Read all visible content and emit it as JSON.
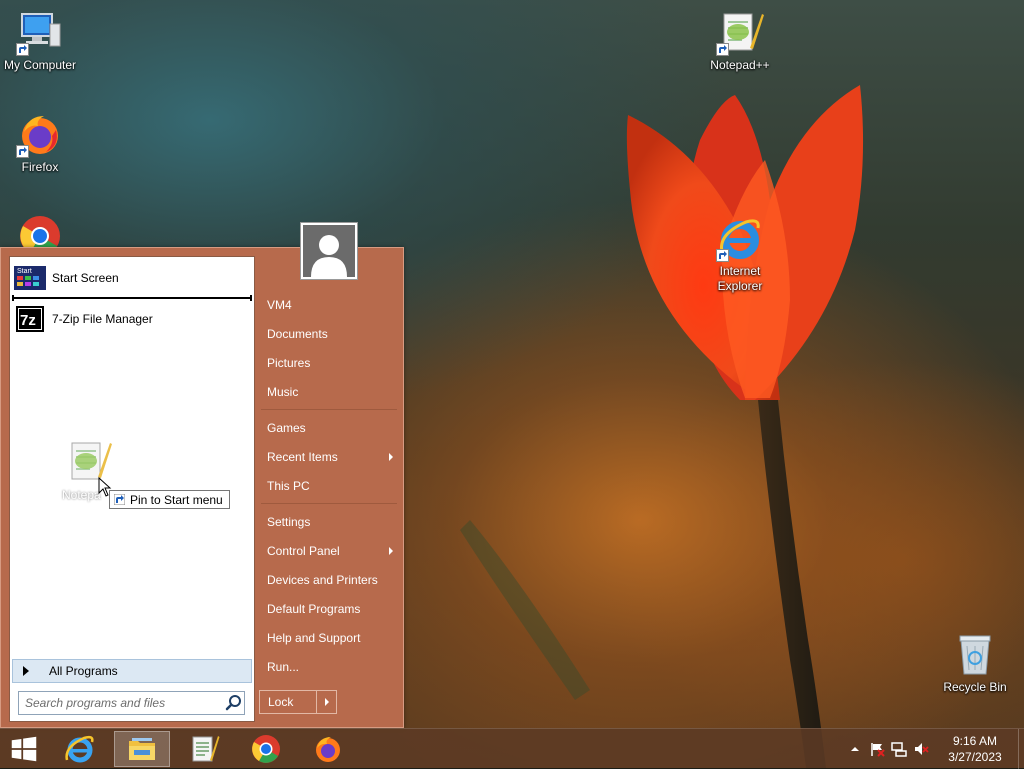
{
  "desktop": {
    "icons": [
      {
        "label": "My Computer",
        "icon": "computer-icon"
      },
      {
        "label": "Firefox",
        "icon": "firefox-icon"
      },
      {
        "label": "Notepad++",
        "icon": "notepadpp-icon"
      },
      {
        "label": "Internet Explorer",
        "icon": "ie-icon"
      },
      {
        "label": "Recycle Bin",
        "icon": "recycle-bin-icon"
      }
    ]
  },
  "start_menu": {
    "left": {
      "pinned": [
        {
          "label": "Start Screen",
          "icon": "start-screen-icon"
        },
        {
          "label": "7-Zip File Manager",
          "icon": "7zip-icon"
        }
      ],
      "dragged_label": "Notepa",
      "pin_tooltip": "Pin to Start menu",
      "all_programs": "All Programs",
      "search_placeholder": "Search programs and files"
    },
    "right": {
      "items": [
        {
          "label": "VM4"
        },
        {
          "label": "Documents"
        },
        {
          "label": "Pictures"
        },
        {
          "label": "Music"
        },
        {
          "label": "Games"
        },
        {
          "label": "Recent Items",
          "submenu": true
        },
        {
          "label": "This PC"
        },
        {
          "label": "Settings"
        },
        {
          "label": "Control Panel",
          "submenu": true
        },
        {
          "label": "Devices and Printers"
        },
        {
          "label": "Default Programs"
        },
        {
          "label": "Help and Support"
        },
        {
          "label": "Run..."
        }
      ],
      "lock_label": "Lock"
    }
  },
  "taskbar": {
    "pinned": [
      "start-button",
      "internet-explorer",
      "file-explorer",
      "notepad-plus-plus",
      "chrome",
      "firefox"
    ],
    "active": "file-explorer",
    "tray": {
      "time": "9:16 AM",
      "date": "3/27/2023"
    }
  },
  "colors": {
    "start_menu_bg": "#b76a4c",
    "taskbar_bg": "#5c3a24"
  }
}
